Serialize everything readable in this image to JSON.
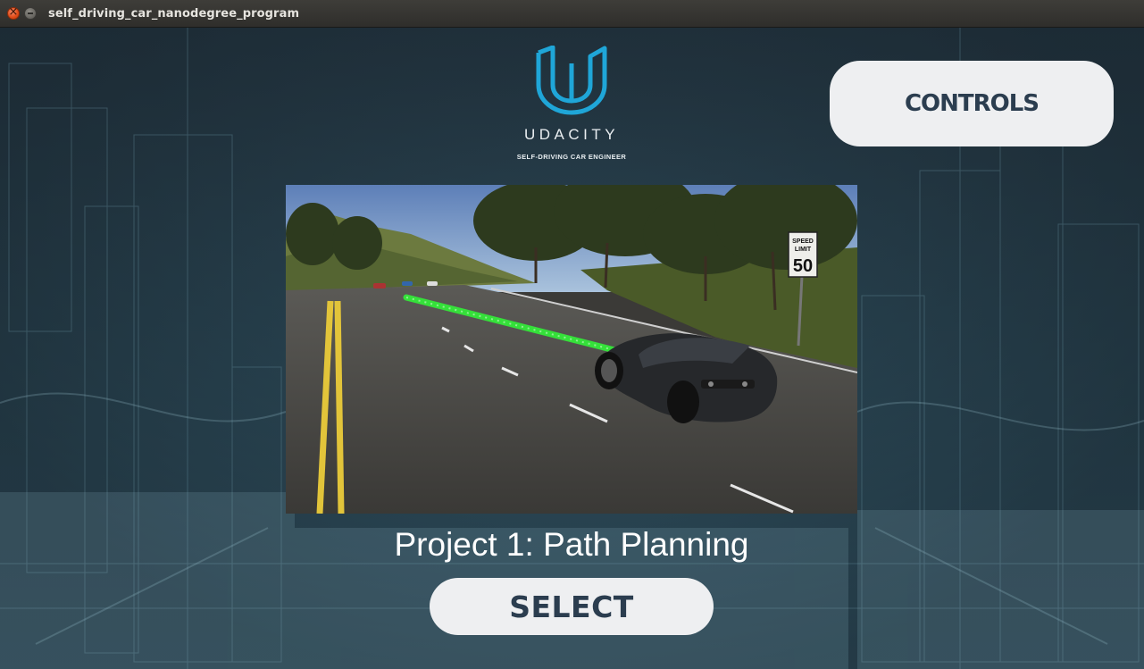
{
  "window": {
    "title": "self_driving_car_nanodegree_program"
  },
  "logo": {
    "brand": "UDACITY",
    "tagline": "SELF-DRIVING CAR ENGINEER",
    "color": "#1fa6d8"
  },
  "buttons": {
    "controls_label": "CONTROLS",
    "select_label": "SELECT"
  },
  "project": {
    "title": "Project 1: Path Planning"
  },
  "preview": {
    "speed_sign_top": "SPEED",
    "speed_sign_middle": "LIMIT",
    "speed_sign_value": "50"
  },
  "colors": {
    "button_bg": "#eeeff1",
    "button_text": "#2b3d4f",
    "background": "#243642",
    "path_green": "#35e03a"
  }
}
